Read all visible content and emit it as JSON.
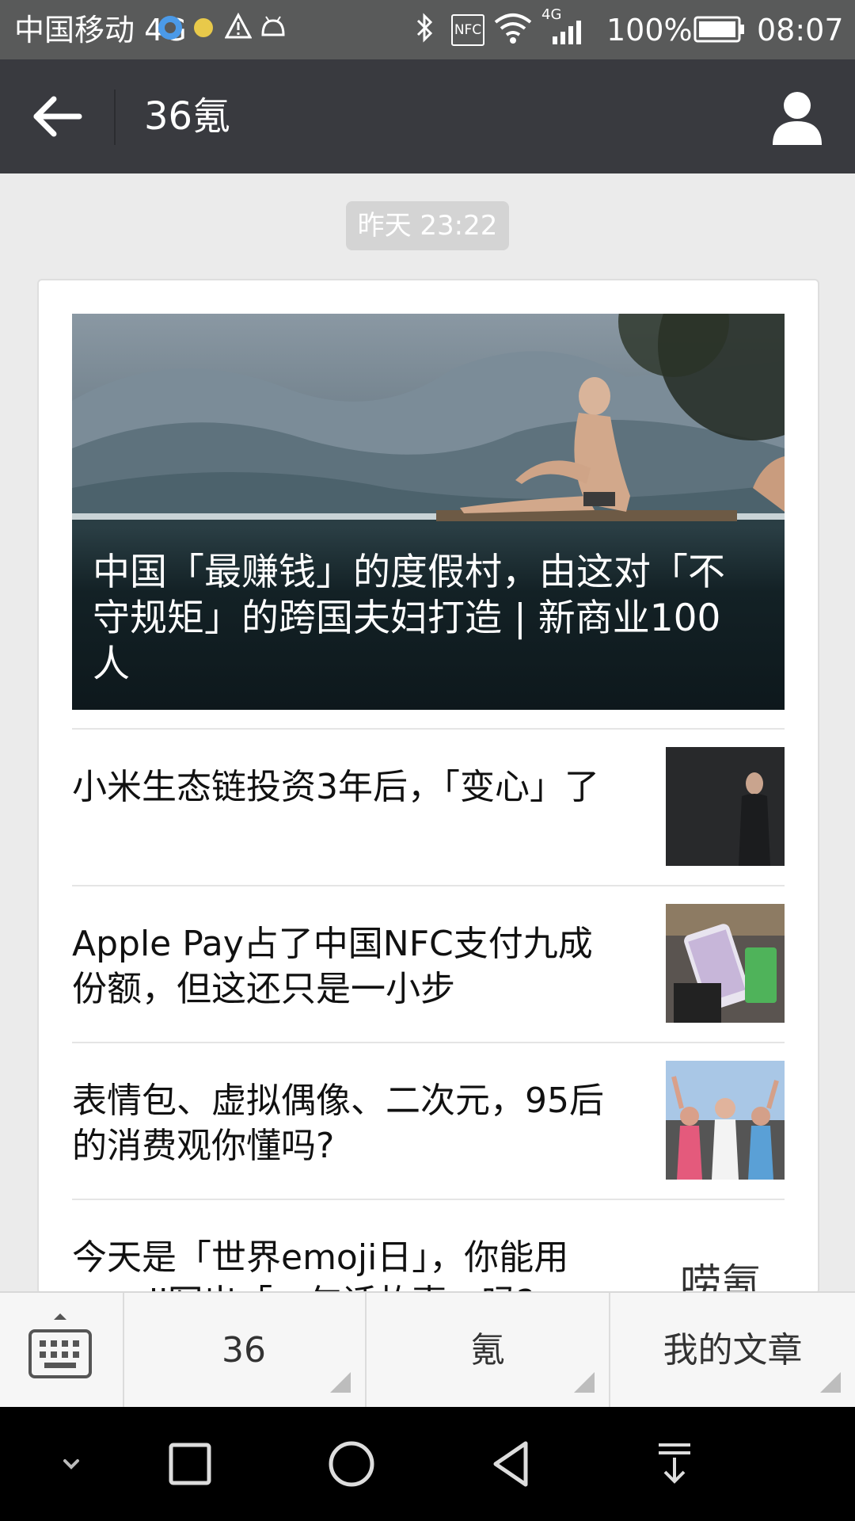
{
  "status_bar": {
    "carrier": "中国移动 4G",
    "right_text": "100%",
    "network_small": "4G",
    "nfc_label": "NFC",
    "time": "08:07",
    "battery_percent": 100
  },
  "header": {
    "title": "36氪",
    "back_icon": "arrow-left-icon",
    "profile_icon": "person-icon"
  },
  "timestamp": "昨天 23:22",
  "articles": {
    "hero": {
      "title": "中国「最赚钱」的度假村，由这对「不守规矩」的跨国夫妇打造 | 新商业100人"
    },
    "items": [
      {
        "title": "小米生态链投资3年后，「变心」了"
      },
      {
        "title": "Apple Pay占了中国NFC支付九成份额，但这还只是一小步"
      },
      {
        "title": "表情包、虚拟偶像、二次元，95后的消费观你懂吗?"
      },
      {
        "title": "今天是「世界emoji日」，你能用emoji写出「一句话故事」吗?",
        "thumb_text": "唠氪"
      }
    ]
  },
  "menu": {
    "keyboard_icon": "keyboard-icon",
    "items": [
      {
        "label": "36"
      },
      {
        "label": "氪"
      },
      {
        "label": "我的文章"
      }
    ]
  },
  "nav_bar": {
    "icons": [
      "chevron-down-icon",
      "square-recents-icon",
      "circle-home-icon",
      "triangle-back-icon",
      "notification-pull-icon"
    ]
  },
  "colors": {
    "status_bar_bg": "#595a5a",
    "title_bar_bg": "#393a3f",
    "page_bg": "#ebebeb",
    "menu_bg": "#f6f6f6",
    "nav_bar_bg": "#000000"
  }
}
